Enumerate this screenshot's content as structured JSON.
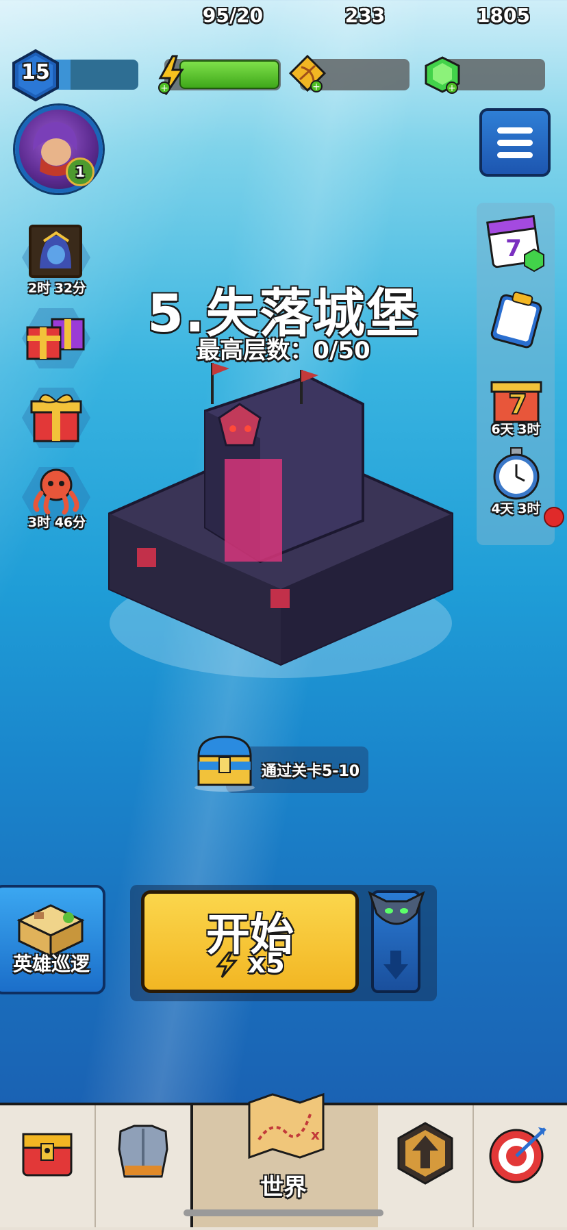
{
  "player": {
    "level": "15",
    "xp_progress": 0.2,
    "avatar_badge": "1"
  },
  "resources": {
    "energy": "95/20",
    "arrows": "233",
    "gems": "1805"
  },
  "left_column": [
    {
      "name": "hooded-hero-offer",
      "timer": "2时 32分"
    },
    {
      "name": "gift-boxes",
      "timer": ""
    },
    {
      "name": "single-gift",
      "timer": ""
    },
    {
      "name": "octopus-event",
      "timer": "3时 46分"
    }
  ],
  "right_column": [
    {
      "name": "calendar-7",
      "timer": ""
    },
    {
      "name": "clipboard-tasks",
      "timer": ""
    },
    {
      "name": "gift-7-days",
      "timer": "6天 3时"
    },
    {
      "name": "stopwatch",
      "timer": "4天 3时"
    }
  ],
  "stage": {
    "title": "5.失落城堡",
    "subtitle": "最高层数：0/50"
  },
  "reward": {
    "label": "通过关卡5-10"
  },
  "patrol": {
    "label": "英雄巡逻"
  },
  "start": {
    "label": "开始",
    "cost": "x5"
  },
  "bottom_nav": [
    {
      "name": "shop",
      "label": ""
    },
    {
      "name": "equipment",
      "label": ""
    },
    {
      "name": "world",
      "label": "世界"
    },
    {
      "name": "upgrade",
      "label": ""
    },
    {
      "name": "challenge",
      "label": ""
    }
  ],
  "colors": {
    "energy_green": "#4fbf24",
    "start_yellow": "#f6c531",
    "button_blue": "#1d66c0"
  }
}
